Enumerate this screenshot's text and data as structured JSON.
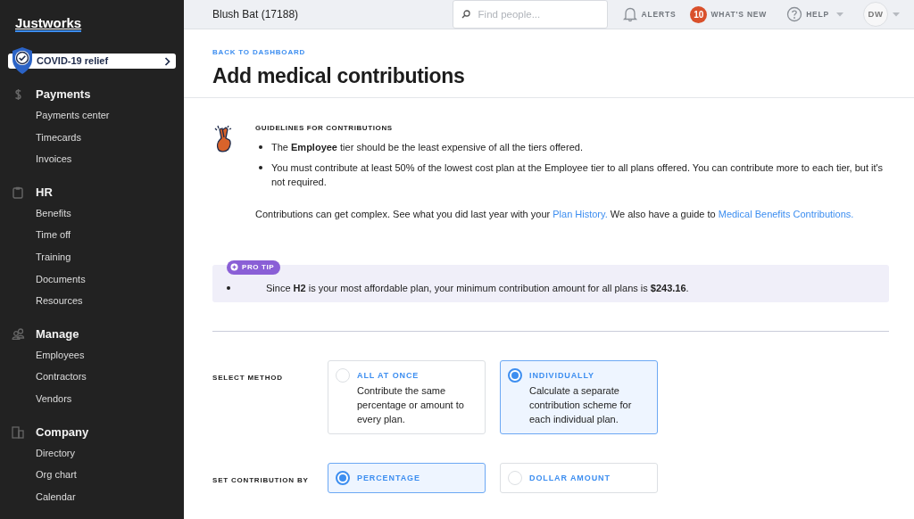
{
  "sidebar": {
    "logo": "Justworks",
    "covid_button": "COVID-19 relief",
    "sections": [
      {
        "title": "Payments",
        "items": [
          "Payments center",
          "Timecards",
          "Invoices"
        ]
      },
      {
        "title": "HR",
        "items": [
          "Benefits",
          "Time off",
          "Training",
          "Documents",
          "Resources"
        ]
      },
      {
        "title": "Manage",
        "items": [
          "Employees",
          "Contractors",
          "Vendors"
        ]
      },
      {
        "title": "Company",
        "items": [
          "Directory",
          "Org chart",
          "Calendar"
        ]
      }
    ]
  },
  "topbar": {
    "company": "Blush Bat (17188)",
    "search": {
      "placeholder": "Find people..."
    },
    "alerts": "ALERTS",
    "whats_new": {
      "count": "10",
      "label": "WHAT'S NEW"
    },
    "help": "HELP",
    "avatar": "DW"
  },
  "back_link": "BACK TO DASHBOARD",
  "title": "Add medical contributions",
  "guidelines": {
    "heading": "GUIDELINES FOR CONTRIBUTIONS",
    "bullets": [
      "The **Employee** tier should be the least expensive of all the tiers offered.",
      "You must contribute at least 50% of the lowest cost plan at the Employee tier to all plans offered. You can contribute more to each tier, but it's not required."
    ],
    "note": [
      {
        "kind": "text",
        "text": "Contributions can get complex. See what you did last year with your "
      },
      {
        "kind": "link",
        "text": "Plan History."
      },
      {
        "kind": "text",
        "text": " We also have a guide to "
      },
      {
        "kind": "link",
        "text": "Medical Benefits Contributions."
      }
    ]
  },
  "pro_tip": {
    "badge": "PRO TIP",
    "bullets": [
      "Since **H2** is your most affordable plan, your minimum contribution amount for all plans is **$243.16**."
    ]
  },
  "fields": [
    {
      "label": "SELECT METHOD",
      "options": [
        {
          "title": "ALL AT ONCE",
          "description": "Contribute the same percentage or amount to every plan.",
          "selected": false
        },
        {
          "title": "INDIVIDUALLY",
          "description": "Calculate a separate contribution scheme for each individual plan.",
          "selected": true
        }
      ]
    },
    {
      "label": "SET CONTRIBUTION BY",
      "options": [
        {
          "title": "PERCENTAGE",
          "selected": true
        },
        {
          "title": "DOLLAR AMOUNT",
          "selected": false
        }
      ]
    }
  ]
}
